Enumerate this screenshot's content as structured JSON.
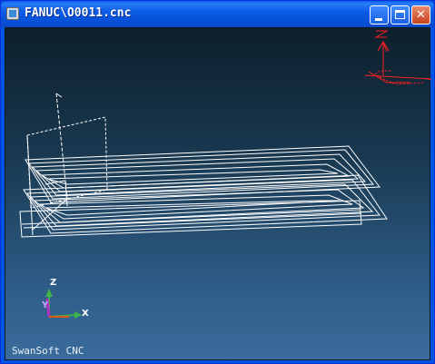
{
  "window": {
    "title": "FANUC\\O0011.cnc"
  },
  "axis": {
    "x": "X",
    "y": "Y",
    "z": "Z"
  },
  "footer": {
    "brand": "SwanSoft CNC"
  },
  "icons": {
    "app": "app-icon",
    "minimize": "minimize-icon",
    "maximize": "maximize-icon",
    "close": "close-icon"
  },
  "colors": {
    "viewport_top": "#0c1f2b",
    "viewport_bottom": "#3a6c9c",
    "toolpath": "#ffffff",
    "reference": "#ff2020"
  }
}
